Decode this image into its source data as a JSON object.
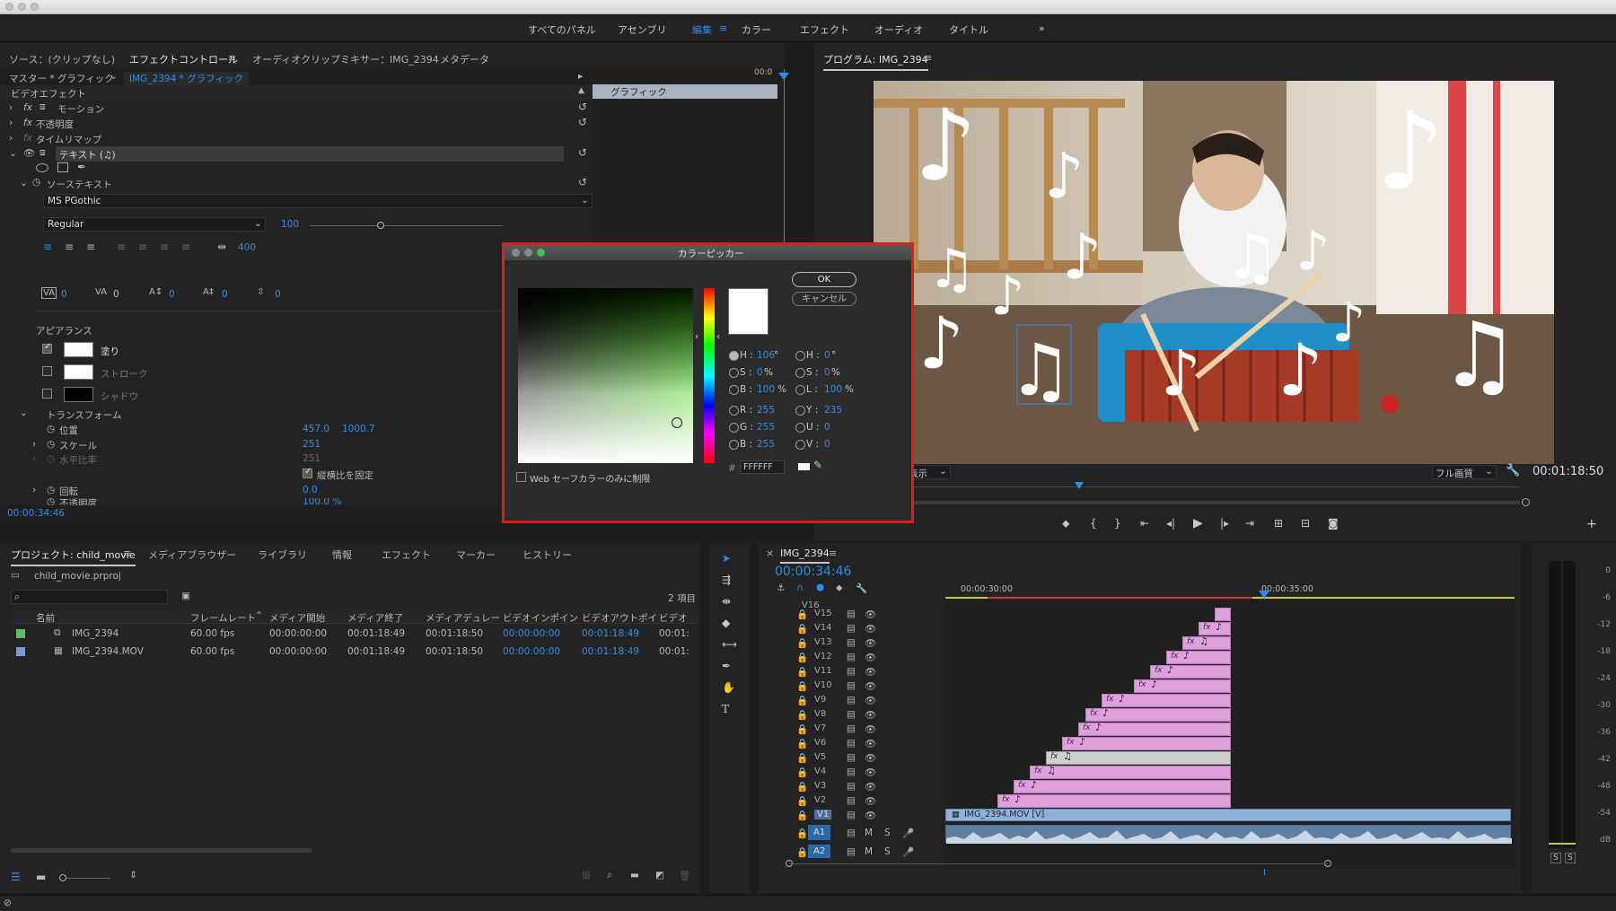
{
  "nav": [
    "すべてのパネル",
    "アセンブリ",
    "編集",
    "カラー",
    "エフェクト",
    "オーディオ",
    "タイトル"
  ],
  "nav_more": "»",
  "effect_panel": {
    "tabs": [
      "ソース：(クリップなし)",
      "エフェクトコントロール",
      "オーディオクリップミキサー：IMG_2394",
      "メタデータ"
    ],
    "master": "マスター * グラフィック",
    "clip": "IMG_2394 * グラフィック",
    "timeline_clip": "グラフィック",
    "section": "ビデオエフェクト",
    "motion": "モーション",
    "opacity": "不透明度",
    "timeremap": "タイムリマップ",
    "text": "テキスト (♫)",
    "source_text": "ソーステキスト",
    "font": "MS PGothic",
    "style": "Regular",
    "size": "100",
    "tracking_val": "400",
    "kerning": [
      "0",
      "0",
      "0",
      "0",
      "0"
    ],
    "appearance": "アピアランス",
    "fill": "塗り",
    "stroke": "ストローク",
    "shadow": "シャドウ",
    "transform": "トランスフォーム",
    "position_label": "位置",
    "position_x": "457.0",
    "position_y": "1000.7",
    "scale_label": "スケール",
    "scale": "251",
    "scale_w_label": "水平比率",
    "scale_w": "251",
    "uniform": "縦横比を固定",
    "rotate_label": "回転",
    "rotate": "0.0",
    "opacity2_label": "不透明度",
    "opacity2": "100.0 %",
    "timecode": "00:00:34:46",
    "ruler_time": "00:0"
  },
  "color_picker": {
    "title": "カラーピッカー",
    "ok": "OK",
    "cancel": "キャンセル",
    "h": "106",
    "h_unit": "°",
    "s": "0",
    "s_unit": "%",
    "b": "100",
    "b_unit": "%",
    "h2": "0",
    "h2_unit": "°",
    "s2": "0",
    "s2_unit": "%",
    "l": "100",
    "l_unit": "%",
    "r": "255",
    "g": "255",
    "bb": "255",
    "y": "235",
    "u": "0",
    "v": "0",
    "hex": "FFFFFF",
    "web_safe": "Web セーフカラーのみに制限",
    "labels": {
      "h": "H :",
      "s": "S :",
      "b": "B :",
      "r": "R :",
      "g": "G :",
      "bb": "B :",
      "h2": "H :",
      "s2": "S :",
      "l": "L :",
      "y": "Y :",
      "u": "U :",
      "v": "V :",
      "hash": "#"
    }
  },
  "program": {
    "title": "プログラム: IMG_2394",
    "fit": "全体表示",
    "quality": "フル画質",
    "timecode": "00:01:18:50"
  },
  "project": {
    "tabs": [
      "プロジェクト: child_movie",
      "メディアブラウザー",
      "ライブラリ",
      "情報",
      "エフェクト",
      "マーカー",
      "ヒストリー"
    ],
    "file": "child_movie.prproj",
    "count": "2 項目",
    "columns": [
      "名前",
      "フレームレート",
      "メディア開始",
      "メディア終了",
      "メディアデュレー",
      "ビデオインポイン",
      "ビデオアウトポイ",
      "ビデオ"
    ],
    "rows": [
      {
        "name": "IMG_2394",
        "fps": "60.00 fps",
        "start": "00:00:00:00",
        "end": "00:01:18:49",
        "dur": "00:01:18:50",
        "in": "00:00:00:00",
        "out": "00:01:18:49",
        "v": "00:01:",
        "color": "#5fbf5f"
      },
      {
        "name": "IMG_2394.MOV",
        "fps": "60.00 fps",
        "start": "00:00:00:00",
        "end": "00:01:18:49",
        "dur": "00:01:18:50",
        "in": "00:00:00:00",
        "out": "00:01:18:49",
        "v": "00:01:",
        "color": "#7a9ad6"
      }
    ]
  },
  "timeline": {
    "title": "IMG_2394",
    "timecode": "00:00:34:46",
    "ruler": [
      "00:00:30:00",
      "00:00:35:00"
    ],
    "tracks": [
      "V16",
      "V15",
      "V14",
      "V13",
      "V12",
      "V11",
      "V10",
      "V9",
      "V8",
      "V7",
      "V6",
      "V5",
      "V4",
      "V3",
      "V2",
      "V1",
      "A1",
      "A2"
    ],
    "v1_clip": "IMG_2394.MOV [V]",
    "m": "M",
    "s": "S"
  },
  "meter": {
    "labels": [
      "0",
      "-6",
      "-12",
      "-18",
      "-24",
      "-30",
      "-36",
      "-42",
      "-48",
      "-54",
      "dB"
    ],
    "solo": [
      "S",
      "S"
    ]
  }
}
